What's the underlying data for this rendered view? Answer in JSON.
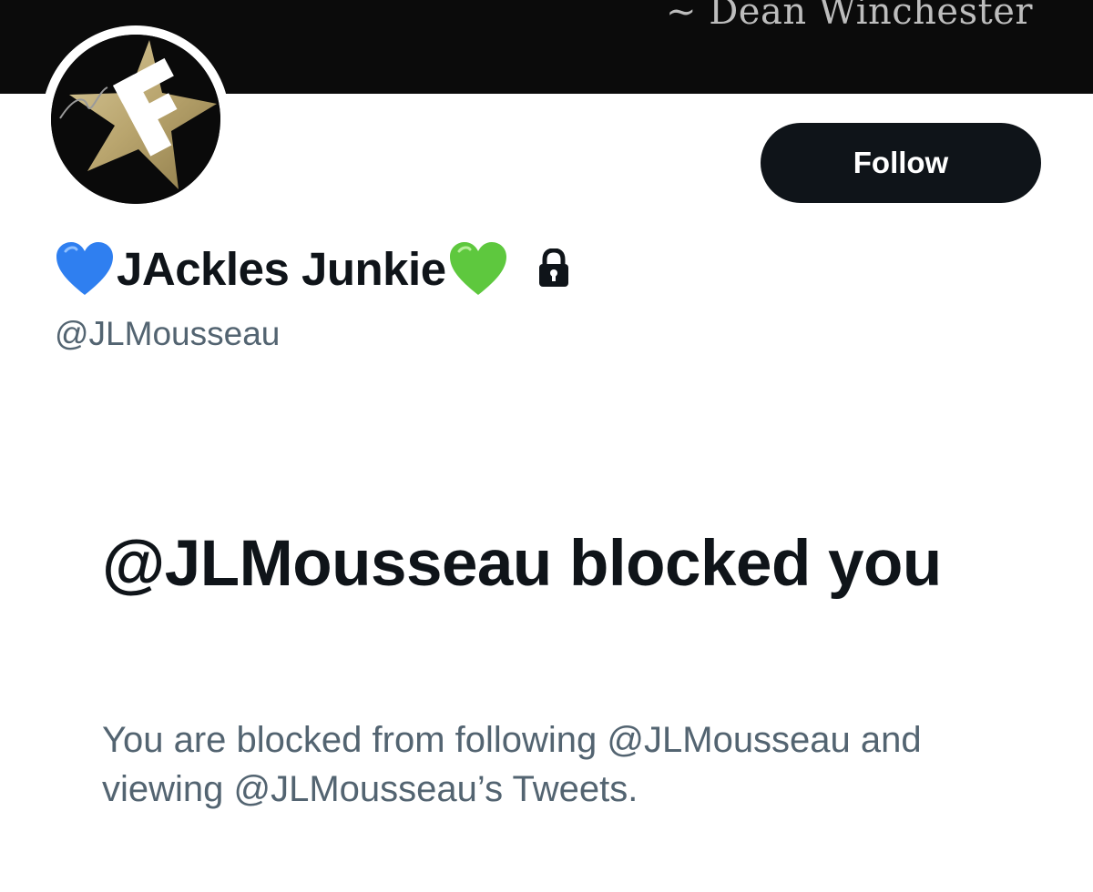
{
  "banner": {
    "quote_text": "~ Dean Winchester"
  },
  "profile": {
    "heart_left_emoji": "💙",
    "display_name": "JAckles Junkie",
    "heart_right_emoji": "💚",
    "protected_icon": "lock-icon",
    "handle": "@JLMousseau",
    "avatar_icon": "gold-star-with-F-avatar"
  },
  "actions": {
    "follow_label": "Follow"
  },
  "blocked": {
    "title": "@JLMousseau blocked you",
    "description": "You are blocked from following @JLMousseau and viewing @JLMousseau’s Tweets."
  },
  "colors": {
    "primary_text": "#0f1419",
    "secondary_text": "#536471",
    "button_bg": "#0f1419",
    "banner_bg": "#0b0b0b",
    "blue_heart": "#2f7ff0",
    "green_heart": "#5ec83e"
  }
}
